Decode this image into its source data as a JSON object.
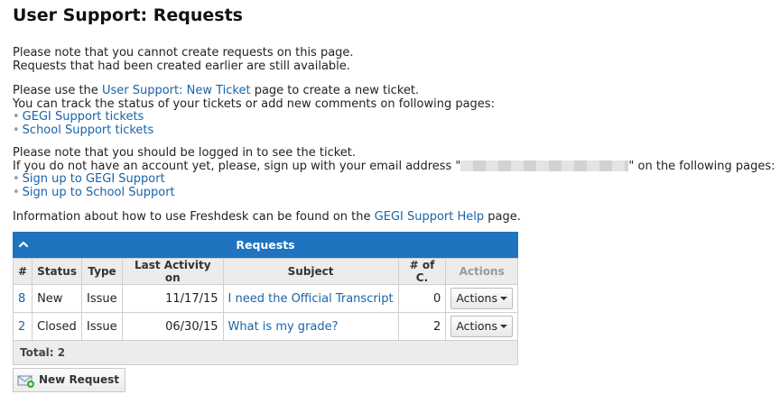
{
  "page": {
    "title": "User Support: Requests"
  },
  "notice": {
    "line1": "Please note that you cannot create requests on this page.",
    "line2": "Requests that had been created earlier are still available."
  },
  "new_ticket": {
    "prefix": "Please use the ",
    "link": "User Support: New Ticket",
    "suffix": " page to create a new ticket.",
    "track_text": "You can track the status of your tickets or add new comments on following pages:",
    "links": [
      "GEGI Support tickets",
      "School Support tickets"
    ]
  },
  "login": {
    "line1": "Please note that you should be logged in to see the ticket.",
    "line2_prefix": "If you do not have an account yet, please, sign up with your email address \"",
    "line2_suffix": "\" on the following pages:",
    "links": [
      "Sign up to GEGI Support",
      "Sign up to School Support"
    ]
  },
  "help": {
    "prefix": "Information about how to use Freshdesk can be found on the ",
    "link": "GEGI Support Help",
    "suffix": " page."
  },
  "grid": {
    "title": "Requests",
    "columns": [
      "#",
      "Status",
      "Type",
      "Last Activity on",
      "Subject",
      "# of C.",
      "Actions"
    ],
    "rows": [
      {
        "id": "8",
        "status": "New",
        "type": "Issue",
        "last_activity": "11/17/15",
        "subject": "I need the Official Transcript",
        "comments": "0",
        "action": "Actions"
      },
      {
        "id": "2",
        "status": "Closed",
        "type": "Issue",
        "last_activity": "06/30/15",
        "subject": "What is my grade?",
        "comments": "2",
        "action": "Actions"
      }
    ],
    "total": "Total: 2"
  },
  "new_request_button": "New Request",
  "colors": {
    "header_blue": "#1f73bf",
    "link": "#1a63a8"
  }
}
